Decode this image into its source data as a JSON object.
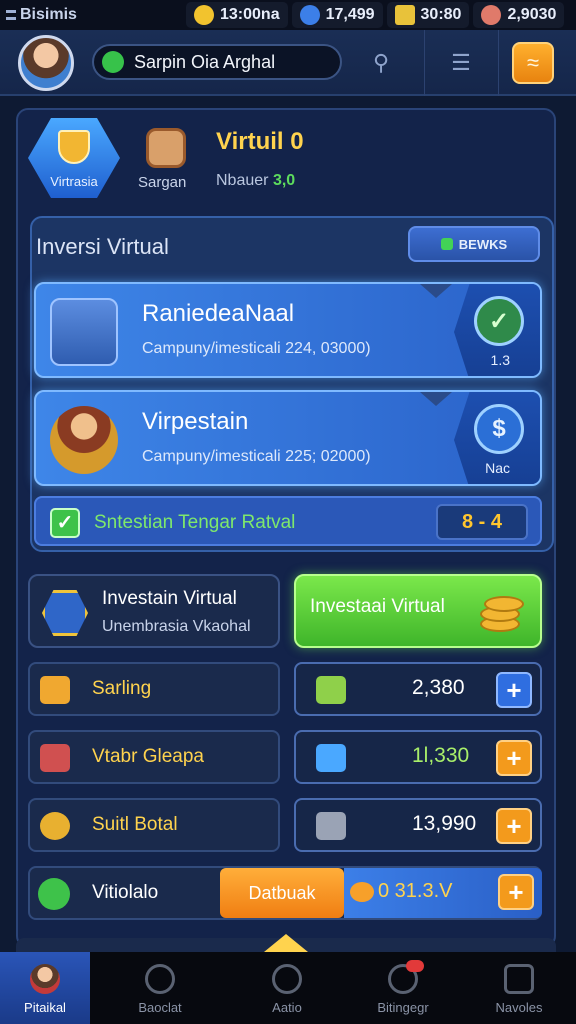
{
  "topbar": {
    "brand": "Bisimis",
    "resources": [
      {
        "icon": "coin-icon",
        "value": "13:00na"
      },
      {
        "icon": "gear-icon",
        "value": "17,499"
      },
      {
        "icon": "key-icon",
        "value": "30:80"
      },
      {
        "icon": "gem-icon",
        "value": "2,9030"
      }
    ]
  },
  "profile": {
    "name": "Sarpin Oia Arghal"
  },
  "hero": {
    "badge_label": "Virtrasia",
    "item_label": "Sargan",
    "title": "Virtuil 0",
    "sub_label": "Nbauer",
    "sub_value": "3,0"
  },
  "investment": {
    "title": "Inversi Virtual",
    "bonus_button": "BEWKS",
    "slots": [
      {
        "title": "RaniedeaNaal",
        "subtitle": "Campuny/imesticali 224, 03000)",
        "side_value": "1.3",
        "side_icon": "check-badge-icon"
      },
      {
        "title": "Virpestain",
        "subtitle": "Campuny/imesticali 225; 02000)",
        "side_value": "Nac",
        "side_icon": "dollar-icon"
      }
    ],
    "bonus_row": {
      "text": "Sntestian Tengar Ratval",
      "counter": "8 - 4"
    }
  },
  "actions": {
    "dark_title": "Investain Virtual",
    "dark_sub": "Unembrasia Vkaohal",
    "green_title": "Investaai Virtual"
  },
  "rows": [
    {
      "label": "Sarling",
      "value": "2,380",
      "plus_color": "blue"
    },
    {
      "label": "Vtabr Gleapa",
      "value": "1l,330",
      "plus_color": "orange"
    },
    {
      "label": "Suitl Botal",
      "value": "13,990",
      "plus_color": "orange"
    }
  ],
  "last_row": {
    "label": "Vitiolalo",
    "button": "Datbuak",
    "value": "0  31.3.V"
  },
  "nav": [
    {
      "label": "Pitaikal",
      "active": true
    },
    {
      "label": "Baoclat"
    },
    {
      "label": "Aatio"
    },
    {
      "label": "Bitingegr"
    },
    {
      "label": "Navoles"
    }
  ],
  "colors": {
    "accent_gold": "#ffd34e",
    "accent_green": "#3fb52a",
    "accent_orange": "#f07e12",
    "panel_blue": "#1c3564"
  }
}
